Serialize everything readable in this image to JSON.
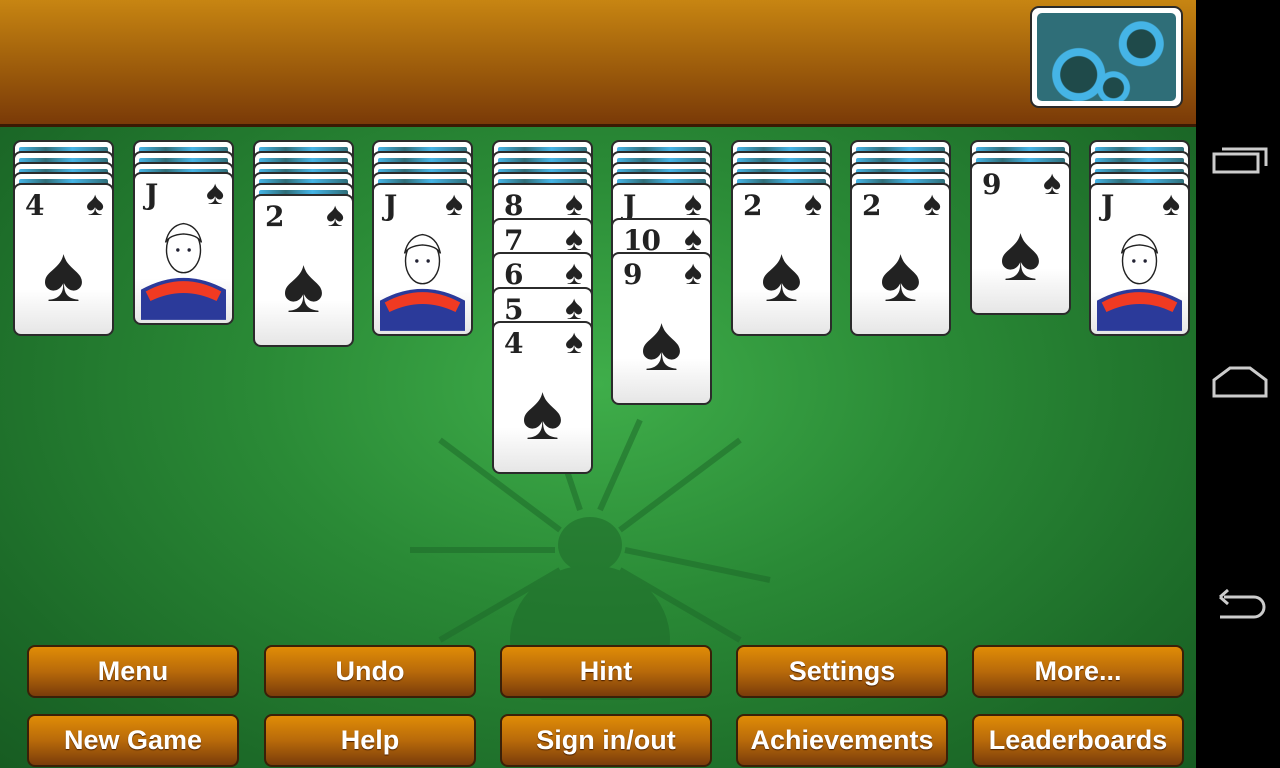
{
  "colors": {
    "felt": "#2a8a36",
    "topbar": "#a4630c",
    "button": "#c27210",
    "card_back": "#45b4e6"
  },
  "stock": {
    "icon": "card-back-stock"
  },
  "tableau": [
    {
      "face_down": 4,
      "face_up": [
        {
          "rank": "4",
          "suit": "♠"
        }
      ]
    },
    {
      "face_down": 3,
      "face_up": [
        {
          "rank": "J",
          "suit": "♠"
        }
      ]
    },
    {
      "face_down": 5,
      "face_up": [
        {
          "rank": "2",
          "suit": "♠"
        }
      ]
    },
    {
      "face_down": 4,
      "face_up": [
        {
          "rank": "J",
          "suit": "♠"
        }
      ]
    },
    {
      "face_down": 4,
      "face_up": [
        {
          "rank": "8",
          "suit": "♠"
        },
        {
          "rank": "7",
          "suit": "♠"
        },
        {
          "rank": "6",
          "suit": "♠"
        },
        {
          "rank": "5",
          "suit": "♠"
        },
        {
          "rank": "4",
          "suit": "♠"
        }
      ]
    },
    {
      "face_down": 4,
      "face_up": [
        {
          "rank": "J",
          "suit": "♠"
        },
        {
          "rank": "10",
          "suit": "♠"
        },
        {
          "rank": "9",
          "suit": "♠"
        }
      ]
    },
    {
      "face_down": 4,
      "face_up": [
        {
          "rank": "2",
          "suit": "♠"
        }
      ]
    },
    {
      "face_down": 4,
      "face_up": [
        {
          "rank": "2",
          "suit": "♠"
        }
      ]
    },
    {
      "face_down": 2,
      "face_up": [
        {
          "rank": "9",
          "suit": "♠"
        }
      ]
    },
    {
      "face_down": 4,
      "face_up": [
        {
          "rank": "J",
          "suit": "♠"
        }
      ]
    }
  ],
  "buttons": {
    "row1": [
      "Menu",
      "Undo",
      "Hint",
      "Settings",
      "More..."
    ],
    "row2": [
      "New Game",
      "Help",
      "Sign in/out",
      "Achievements",
      "Leaderboards"
    ]
  },
  "navbar": [
    "recent-apps-icon",
    "home-icon",
    "back-icon"
  ]
}
